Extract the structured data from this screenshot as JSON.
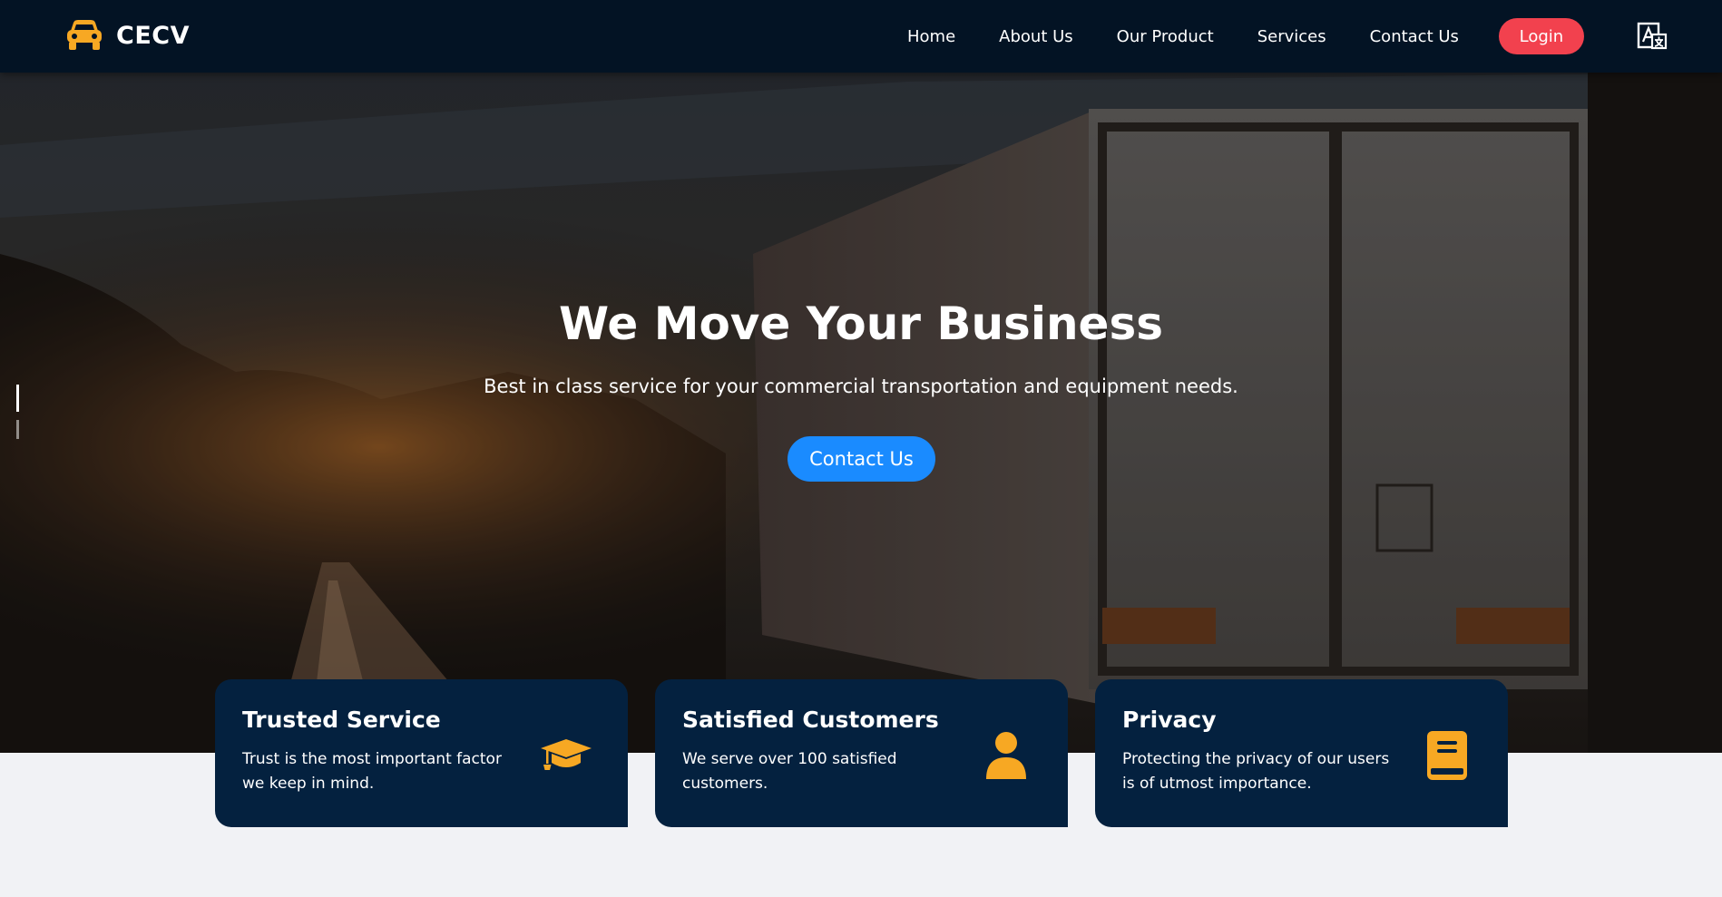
{
  "header": {
    "brand": "CECV",
    "brand_icon": "car-icon",
    "nav": [
      "Home",
      "About Us",
      "Our Product",
      "Services",
      "Contact Us"
    ],
    "login_label": "Login",
    "translate_icon": "translate-icon"
  },
  "hero": {
    "title": "We Move Your Business",
    "subtitle": "Best in class service for your commercial transportation and equipment needs.",
    "cta_label": "Contact Us",
    "slides_total": 2,
    "active_slide": 1
  },
  "features": [
    {
      "title": "Trusted Service",
      "description": "Trust is the most important factor we keep in mind.",
      "icon": "graduation-cap-icon"
    },
    {
      "title": "Satisfied Customers",
      "description": "We serve over 100 satisfied customers.",
      "icon": "user-icon"
    },
    {
      "title": "Privacy",
      "description": "Protecting the privacy of our users is of utmost importance.",
      "icon": "book-icon"
    }
  ],
  "colors": {
    "nav_bg": "#031324",
    "accent_orange": "#f7a823",
    "login_red": "#f2414e",
    "cta_blue": "#1a8bff",
    "card_bg": "#04213f",
    "page_bg": "#f1f2f5"
  }
}
